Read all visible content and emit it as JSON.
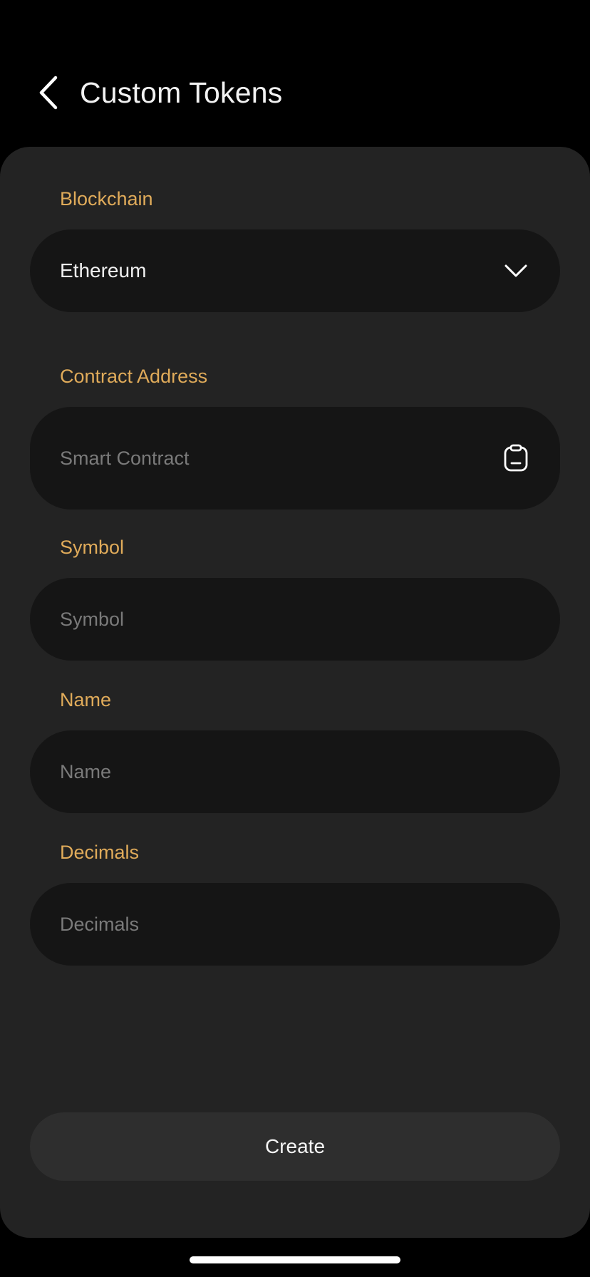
{
  "header": {
    "title": "Custom Tokens",
    "back_icon": "chevron-left-icon"
  },
  "form": {
    "blockchain": {
      "label": "Blockchain",
      "value": "Ethereum",
      "icon": "chevron-down-icon"
    },
    "contract_address": {
      "label": "Contract Address",
      "placeholder": "Smart Contract",
      "icon": "clipboard-paste-icon"
    },
    "symbol": {
      "label": "Symbol",
      "placeholder": "Symbol"
    },
    "name": {
      "label": "Name",
      "placeholder": "Name"
    },
    "decimals": {
      "label": "Decimals",
      "placeholder": "Decimals"
    }
  },
  "actions": {
    "create_label": "Create"
  },
  "colors": {
    "background": "#000000",
    "card": "#232323",
    "field": "#151515",
    "label_accent": "#e0ab5a",
    "button": "#2e2e2e"
  }
}
